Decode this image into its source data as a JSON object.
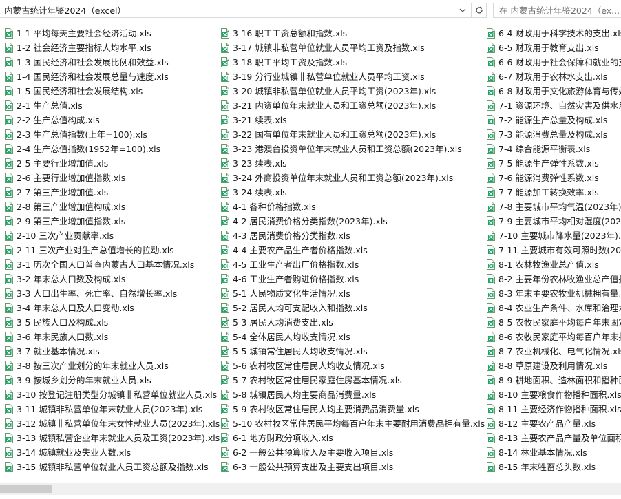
{
  "address_bar": {
    "path": "内蒙古统计年鉴2024（excel）"
  },
  "search": {
    "placeholder": "在 内蒙古统计年鉴2024（ex..."
  },
  "icons": {
    "file": "excel-file-icon",
    "dropdown": "chevron-down-icon",
    "refresh": "refresh-icon"
  },
  "colors": {
    "excel_green": "#21a366",
    "excel_dark": "#107c41"
  },
  "columns": [
    {
      "items": [
        "1-1 平均每天主要社会经济活动.xls",
        "1-2 社会经济主要指标人均水平.xls",
        "1-3 国民经济和社会发展比例和效益.xls",
        "1-4 国民经济和社会发展总量与速度.xls",
        "1-5 国民经济和社会发展结构.xls",
        "2-1 生产总值.xls",
        "2-2 生产总值构成.xls",
        "2-3 生产总值指数(上年=100).xls",
        "2-4 生产总值指数(1952年=100).xls",
        "2-5 主要行业增加值.xls",
        "2-6 主要行业增加值指数.xls",
        "2-7 第三产业增加值.xls",
        "2-8 第三产业增加值构成.xls",
        "2-9 第三产业增加值指数.xls",
        "2-10 三次产业贡献率.xls",
        "2-11 三次产业对生产总值增长的拉动.xls",
        "3-1 历次全国人口普查内蒙古人口基本情况.xls",
        "3-2 年末总人口数及构成.xls",
        "3-3 人口出生率、死亡率、自然增长率.xls",
        "3-4 年末总人口及人口变动.xls",
        "3-5 民族人口及构成.xls",
        "3-6 年末民族人口数.xls",
        "3-7 就业基本情况.xls",
        "3-8 按三次产业划分的年末就业人员.xls",
        "3-9 按城乡划分的年末就业人员.xls",
        "3-10 按登记注册类型分城镇非私营单位就业人员.xls",
        "3-11 城镇非私营单位年末就业人员(2023年).xls",
        "3-12 城镇非私营单位年末女性就业人员(2023年).xls",
        "3-13 城镇私营企业年末就业人员及工资(2023年).xls",
        "3-14 城镇就业及失业人数.xls",
        "3-15 城镇非私营单位就业人员工资总额及指数.xls"
      ]
    },
    {
      "items": [
        "3-16 职工工资总额和指数.xls",
        "3-17 城镇非私营单位就业人员平均工资及指数.xls",
        "3-18 职工平均工资及指数.xls",
        "3-19 分行业城镇非私营单位就业人员平均工资.xls",
        "3-20 城镇非私营单位就业人员平均工资(2023年).xls",
        "3-21 内资单位年末就业人员和工资总额(2023年).xls",
        "3-21 续表.xls",
        "3-22 国有单位年末就业人员和工资总额(2023年).xls",
        "3-23 港澳台投资单位年末就业人员和工资总额(2023年).xls",
        "3-23 续表.xls",
        "3-24 外商投资单位年末就业人员和工资总额(2023年).xls",
        "3-24 续表.xls",
        "4-1 各种价格指数.xls",
        "4-2 居民消费价格分类指数(2023年).xls",
        "4-3 居民消费价格分类指数.xls",
        "4-4 主要农产品生产者价格指数.xls",
        "4-5 工业生产者出厂价格指数.xls",
        "4-6 工业生产者购进价格指数.xls",
        "5-1 人民物质文化生活情况.xls",
        "5-2 居民人均可支配收入和指数.xls",
        "5-3 居民人均消费支出.xls",
        "5-4 全体居民人均收支情况.xls",
        "5-5 城镇常住居民人均收支情况.xls",
        "5-6 农村牧区常住居民人均收支情况.xls",
        "5-7 农村牧区常住居民家庭住房基本情况.xls",
        "5-8 城镇居民人均主要商品消费量.xls",
        "5-9 农村牧区常住居民人均主要消费品消费量.xls",
        "5-10 农村牧区常住居民平均每百户年末主要耐用消费品拥有量.xls",
        "6-1 地方财政分项收入.xls",
        "6-2 一般公共预算收入及主要收入项目.xls",
        "6-3 一般公共预算支出及主要支出项目.xls"
      ]
    },
    {
      "items": [
        "6-4 财政用于科学技术的支出.xls",
        "6-5 财政用于教育支出.xls",
        "6-6 财政用于社会保障和就业的支",
        "6-7 财政用于农林水支出.xls",
        "6-8 财政用于文化旅游体育与传媒",
        "7-1 资源环境、自然灾害及供水用",
        "7-2 能源生产总量及构成.xls",
        "7-3 能源消费总量及构成.xls",
        "7-4 综合能源平衡表.xls",
        "7-5 能源生产弹性系数.xls",
        "7-6 能源消费弹性系数.xls",
        "7-7 能源加工转换效率.xls",
        "7-8 主要城市平均气温(2023年).xl",
        "7-9 主要城市平均相对湿度(2023年",
        "7-10 主要城市降水量(2023年).xls",
        "7-11 主要城市有效可照时数(2023",
        "8-1 农林牧渔业总产值.xls",
        "8-2 主要年份农林牧渔业总产值指",
        "8-3 年末主要农牧业机械拥有量.xl",
        "8-4 农业生产条件、水库和治理水",
        "8-5 农牧民家庭平均每户年末固定",
        "8-6 农牧民家庭平均每百户年末拥",
        "8-7 农业机械化、电气化情况.xls",
        "8-8 草原建设及利用情况.xls",
        "8-9 耕地面积、造林面积和播种面",
        "8-10 主要粮食作物播种面积.xls",
        "8-11 主要经济作物播种面积.xls",
        "8-12 主要农产品产量.xls",
        "8-13 主要农产品产量及单位面积产",
        "8-14 林业基本情况.xls",
        "8-15 年末牲畜总头数.xls"
      ]
    }
  ]
}
